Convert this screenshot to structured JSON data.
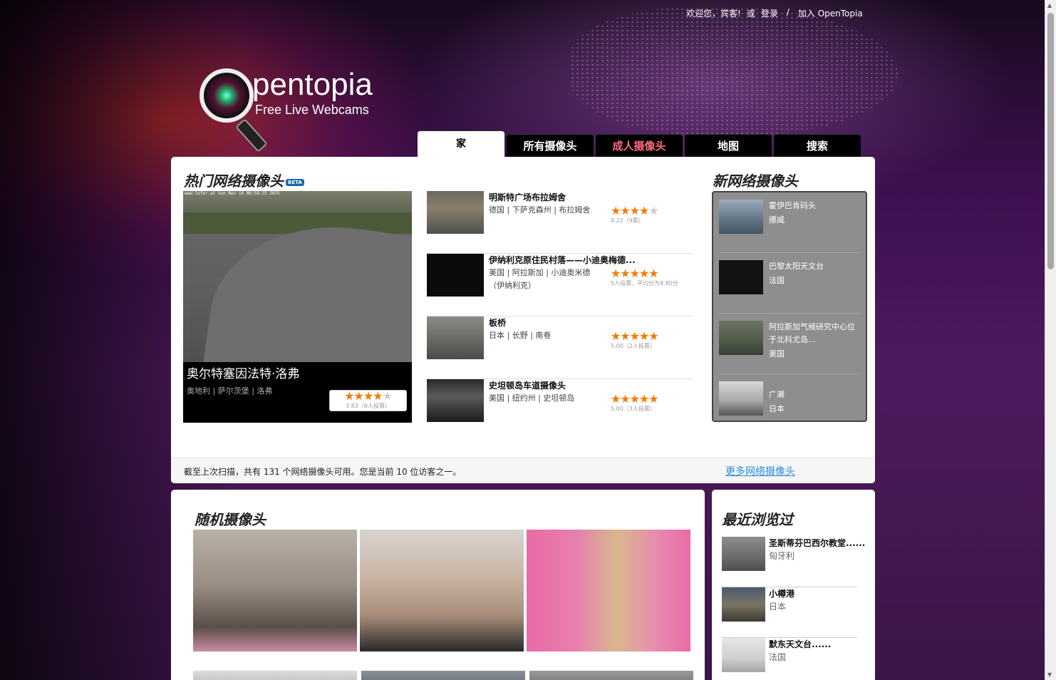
{
  "header": {
    "welcome": "欢迎您，宾客!",
    "or": "或",
    "login": "登录",
    "separator": "/",
    "join": "加入 OpenTopia",
    "logo_name": "pentopia",
    "logo_tagline": "Free Live Webcams"
  },
  "nav": {
    "tabs": [
      {
        "label": "家"
      },
      {
        "label": "所有摄像头"
      },
      {
        "label": "成人摄像头"
      },
      {
        "label": "地图"
      },
      {
        "label": "搜索"
      }
    ]
  },
  "popular": {
    "title": "热门网络摄像头",
    "badge": "BETA",
    "featured": {
      "name": "奥尔特塞因法特·洛弗",
      "location": "奥地利 | 萨尔茨堡 | 洛弗",
      "stars_on": "★★★★",
      "stars_off": "★",
      "votes": "3.83（6人投票）",
      "stamp": "www.lofer.at  Sun Nov 16  08:58:25  2025"
    },
    "items": [
      {
        "title": "明斯特广场布拉姆舍",
        "location": "德国 | 下萨克森州 | 布拉姆舍",
        "stars_on": "★★★★",
        "stars_off": "★",
        "votes": "4.22（9票）"
      },
      {
        "title": "伊纳利克原住民村落——小迪奥梅德...",
        "location": "美国 | 阿拉斯加 | 小迪奥米德（伊纳利克）",
        "stars_on": "★★★★★",
        "stars_off": "",
        "votes": "5人投票，平均分为4.80分"
      },
      {
        "title": "板桥",
        "location": "日本 | 长野 | 南卷",
        "stars_on": "★★★★★",
        "stars_off": "",
        "votes": "5.00（2人投票）"
      },
      {
        "title": "史坦顿岛车道摄像头",
        "location": "美国 | 纽约州 | 史坦顿岛",
        "stars_on": "★★★★★",
        "stars_off": "",
        "votes": "5.00（3人投票）"
      }
    ]
  },
  "new_webcams": {
    "title": "新网络摄像头",
    "items": [
      {
        "title": "霍伊巴肯码头",
        "location": "挪威"
      },
      {
        "title": "巴黎太阳天文台",
        "location": "法国"
      },
      {
        "title": "阿拉斯加气候研究中心位于北科尤岛...",
        "location": "美国"
      },
      {
        "title": "广濑",
        "location": "日本"
      }
    ]
  },
  "status": {
    "text": "截至上次扫描，共有 131 个网络摄像头可用。您是当前 10 位访客之一。",
    "more_link": "更多网络摄像头"
  },
  "random": {
    "title": "随机摄像头"
  },
  "recent": {
    "title": "最近浏览过",
    "items": [
      {
        "title": "圣斯蒂芬巴西尔教堂......",
        "location": "匈牙利"
      },
      {
        "title": "小樽港",
        "location": "日本"
      },
      {
        "title": "默东天文台......",
        "location": "法国"
      }
    ]
  },
  "colors": {
    "accent_link": "#2a8bd6",
    "star": "#f57a00",
    "adult_tab": "#ff6b7a",
    "background": "#3a1547"
  }
}
